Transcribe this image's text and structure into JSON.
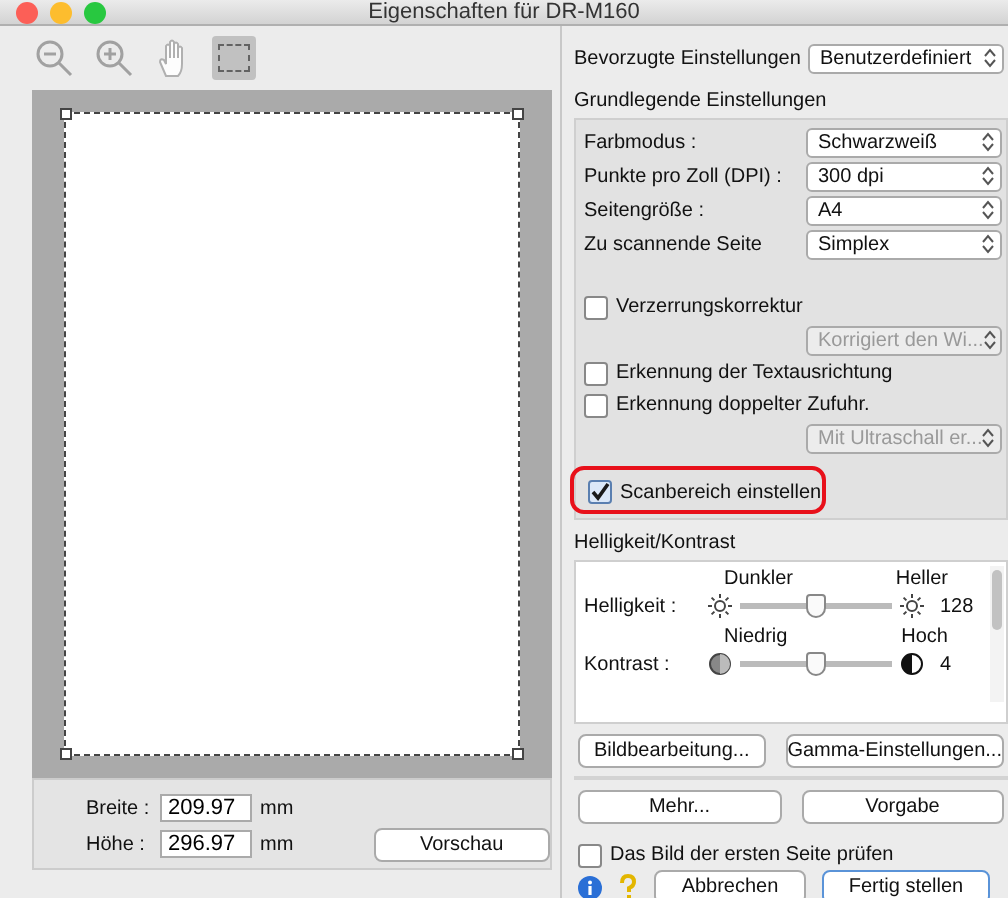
{
  "window": {
    "title": "Eigenschaften für DR-M160"
  },
  "toolbar": {
    "tools": [
      {
        "kind": "zoom-out",
        "selected": false
      },
      {
        "kind": "zoom-in",
        "selected": false
      },
      {
        "kind": "hand",
        "selected": false
      },
      {
        "kind": "select-area",
        "selected": true
      }
    ]
  },
  "preview": {
    "fields": [
      {
        "label": "Breite :",
        "value": "209.97",
        "unit": "mm"
      },
      {
        "label": "Höhe :",
        "value": "296.97",
        "unit": "mm"
      }
    ],
    "button": "Vorschau"
  },
  "preferred": {
    "label": "Bevorzugte Einstellungen",
    "value": "Benutzerdefiniert"
  },
  "basic": {
    "title": "Grundlegende Einstellungen",
    "rows": [
      {
        "label": "Farbmodus :",
        "value": "Schwarzweiß"
      },
      {
        "label": "Punkte pro Zoll (DPI) :",
        "value": "300 dpi"
      },
      {
        "label": "Seitengröße :",
        "value": "A4"
      },
      {
        "label": "Zu scannende Seite",
        "value": "Simplex"
      }
    ],
    "options": [
      {
        "kind": "checkbox",
        "label": "Verzerrungskorrektur",
        "checked": false
      },
      {
        "kind": "select",
        "value": "Korrigiert den Wi...",
        "disabled": true
      },
      {
        "kind": "checkbox",
        "label": "Erkennung der Textausrichtung",
        "checked": false
      },
      {
        "kind": "checkbox",
        "label": "Erkennung doppelter Zufuhr.",
        "checked": false
      },
      {
        "kind": "select",
        "value": "Mit Ultraschall er...",
        "disabled": true
      }
    ]
  },
  "scan_area": {
    "label": "Scanbereich einstellen",
    "checked": true,
    "highlighted": true
  },
  "brightness": {
    "title": "Helligkeit/Kontrast",
    "sliders": [
      {
        "kind": "sun",
        "label": "Helligkeit :",
        "low": "Dunkler",
        "high": "Heller",
        "reading": "128",
        "level": 0.5
      },
      {
        "kind": "contrast",
        "label": "Kontrast :",
        "low": "Niedrig",
        "high": "Hoch",
        "reading": "4",
        "level": 0.5
      }
    ]
  },
  "button_rows": [
    [
      "Bildbearbeitung...",
      "Gamma-Einstellungen..."
    ],
    [
      "Mehr...",
      "Vorgabe"
    ]
  ],
  "check_first_page": {
    "label": "Das Bild der ersten Seite prüfen",
    "checked": false
  },
  "footer_buttons": [
    {
      "label": "Abbrechen",
      "default": false
    },
    {
      "label": "Fertig stellen",
      "default": true
    }
  ]
}
